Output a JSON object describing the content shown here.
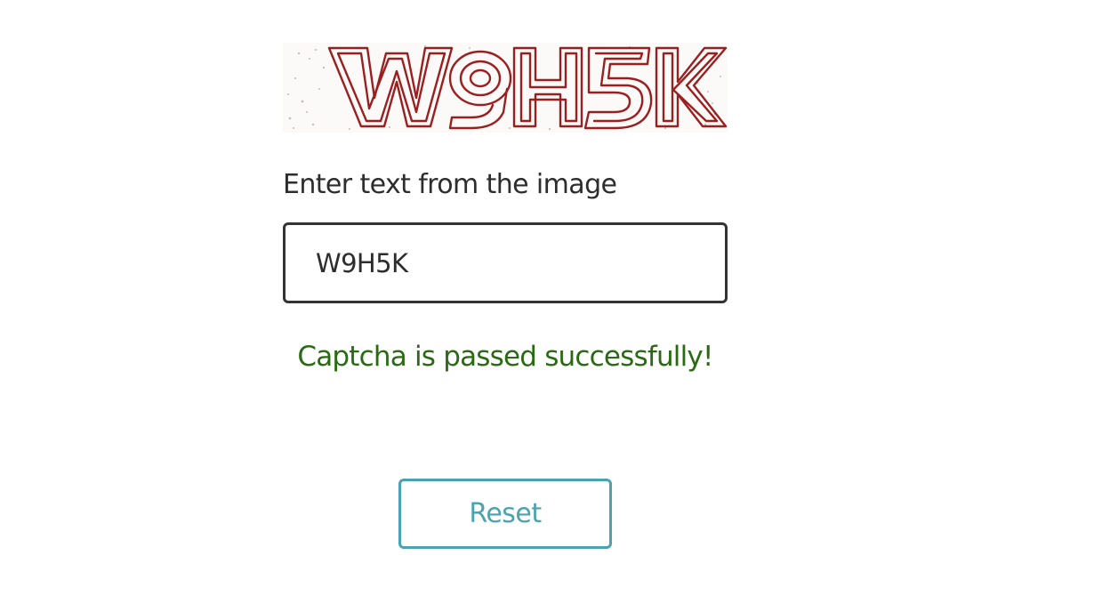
{
  "captcha": {
    "image_text": "W9H5K",
    "ink_color": "#9c1f1f"
  },
  "form": {
    "label": "Enter text from the image",
    "input_value": "W9H5K"
  },
  "status": {
    "message": "Captcha is passed successfully!",
    "color": "#2a6a14"
  },
  "actions": {
    "reset_label": "Reset",
    "accent_color": "#4aa3b0"
  }
}
